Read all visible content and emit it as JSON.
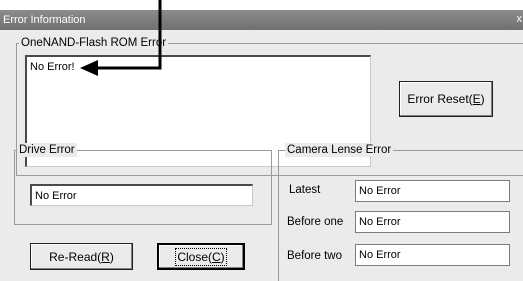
{
  "window": {
    "title": "Error Information",
    "close_glyph": "x"
  },
  "onenand": {
    "legend": "OneNAND-Flash ROM Error",
    "value": "No Error!",
    "reset_button": "Error Reset(E)"
  },
  "drive": {
    "legend": "Drive Error",
    "value": "No Error"
  },
  "camera": {
    "legend": "Camera Lense Error",
    "rows": [
      {
        "label": "Latest",
        "value": "No Error"
      },
      {
        "label": "Before one",
        "value": "No Error"
      },
      {
        "label": "Before two",
        "value": "No Error"
      }
    ]
  },
  "buttons": {
    "reread": "Re-Read(R)",
    "close": "Close(C)"
  },
  "annotation": {
    "arrow_color": "#000000"
  }
}
